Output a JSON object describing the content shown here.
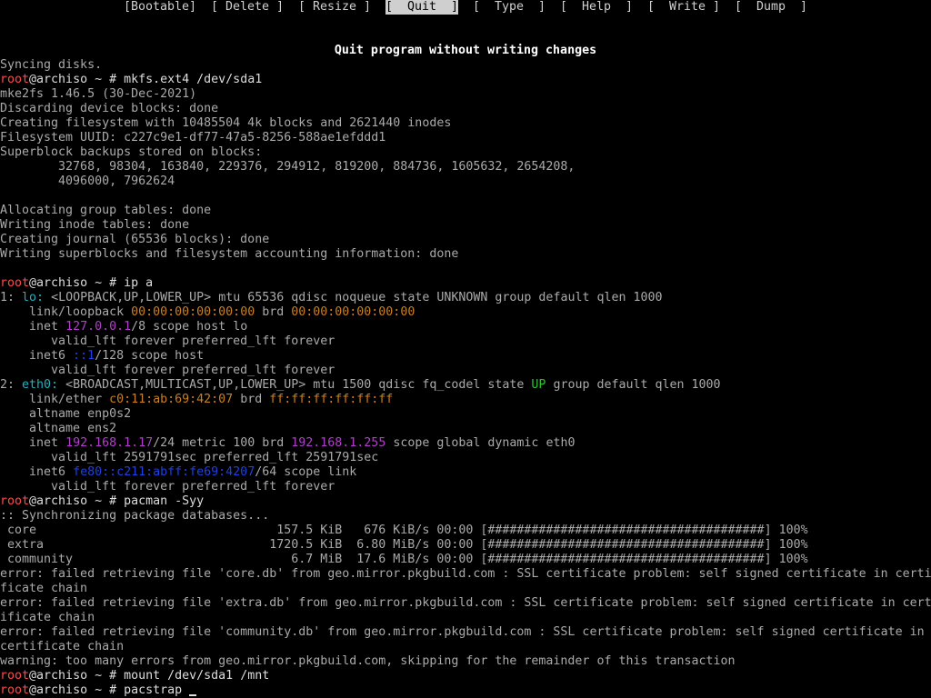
{
  "menu": {
    "items": [
      {
        "label": "[Bootable]",
        "selected": false
      },
      {
        "label": "[ Delete ]",
        "selected": false
      },
      {
        "label": "[ Resize ]",
        "selected": false
      },
      {
        "label": "[  Quit  ]",
        "selected": true
      },
      {
        "label": "[  Type  ]",
        "selected": false
      },
      {
        "label": "[  Help  ]",
        "selected": false
      },
      {
        "label": "[  Write ]",
        "selected": false
      },
      {
        "label": "[  Dump  ]",
        "selected": false
      }
    ]
  },
  "status_message": "Quit program without writing changes",
  "terminal_lines": [
    [
      {
        "t": "Syncing disks."
      }
    ],
    [
      {
        "t": "root",
        "c": "red"
      },
      {
        "t": "@archiso ~ # mkfs.ext4 /dev/sda1",
        "c": "white"
      }
    ],
    [
      {
        "t": "mke2fs 1.46.5 (30-Dec-2021)"
      }
    ],
    [
      {
        "t": "Discarding device blocks: done"
      }
    ],
    [
      {
        "t": "Creating filesystem with 10485504 4k blocks and 2621440 inodes"
      }
    ],
    [
      {
        "t": "Filesystem UUID: c227c9e1-df77-47a5-8256-588ae1efddd1"
      }
    ],
    [
      {
        "t": "Superblock backups stored on blocks:"
      }
    ],
    [
      {
        "t": "        32768, 98304, 163840, 229376, 294912, 819200, 884736, 1605632, 2654208,"
      }
    ],
    [
      {
        "t": "        4096000, 7962624"
      }
    ],
    [
      {
        "t": ""
      }
    ],
    [
      {
        "t": "Allocating group tables: done"
      }
    ],
    [
      {
        "t": "Writing inode tables: done"
      }
    ],
    [
      {
        "t": "Creating journal (65536 blocks): done"
      }
    ],
    [
      {
        "t": "Writing superblocks and filesystem accounting information: done"
      }
    ],
    [
      {
        "t": ""
      }
    ],
    [
      {
        "t": "root",
        "c": "red"
      },
      {
        "t": "@archiso ~ # ip a",
        "c": "white"
      }
    ],
    [
      {
        "t": "1: "
      },
      {
        "t": "lo:",
        "c": "cyan"
      },
      {
        "t": " <LOOPBACK,UP,LOWER_UP> mtu 65536 qdisc noqueue state UNKNOWN group default qlen 1000"
      }
    ],
    [
      {
        "t": "    link/loopback "
      },
      {
        "t": "00:00:00:00:00:00",
        "c": "orange"
      },
      {
        "t": " brd "
      },
      {
        "t": "00:00:00:00:00:00",
        "c": "orange"
      }
    ],
    [
      {
        "t": "    inet "
      },
      {
        "t": "127.0.0.1",
        "c": "magenta"
      },
      {
        "t": "/8 scope host lo"
      }
    ],
    [
      {
        "t": "       valid_lft forever preferred_lft forever"
      }
    ],
    [
      {
        "t": "    inet6 "
      },
      {
        "t": "::1",
        "c": "blue"
      },
      {
        "t": "/128 scope host"
      }
    ],
    [
      {
        "t": "       valid_lft forever preferred_lft forever"
      }
    ],
    [
      {
        "t": "2: "
      },
      {
        "t": "eth0:",
        "c": "cyan"
      },
      {
        "t": " <BROADCAST,MULTICAST,UP,LOWER_UP> mtu 1500 qdisc fq_codel state "
      },
      {
        "t": "UP",
        "c": "green"
      },
      {
        "t": " group default qlen 1000"
      }
    ],
    [
      {
        "t": "    link/ether "
      },
      {
        "t": "c0:11:ab:69:42:07",
        "c": "orange"
      },
      {
        "t": " brd "
      },
      {
        "t": "ff:ff:ff:ff:ff:ff",
        "c": "orange"
      }
    ],
    [
      {
        "t": "    altname enp0s2"
      }
    ],
    [
      {
        "t": "    altname ens2"
      }
    ],
    [
      {
        "t": "    inet "
      },
      {
        "t": "192.168.1.17",
        "c": "magenta"
      },
      {
        "t": "/24 metric 100 brd "
      },
      {
        "t": "192.168.1.255",
        "c": "magenta"
      },
      {
        "t": " scope global dynamic eth0"
      }
    ],
    [
      {
        "t": "       valid_lft 2591791sec preferred_lft 2591791sec"
      }
    ],
    [
      {
        "t": "    inet6 "
      },
      {
        "t": "fe80::c211:abff:fe69:4207",
        "c": "blue"
      },
      {
        "t": "/64 scope link"
      }
    ],
    [
      {
        "t": "       valid_lft forever preferred_lft forever"
      }
    ],
    [
      {
        "t": "root",
        "c": "red"
      },
      {
        "t": "@archiso ~ # pacman -Syy",
        "c": "white"
      }
    ],
    [
      {
        "t": ":: Synchronizing package databases..."
      }
    ],
    [
      {
        "t": " core                                 157.5 KiB   676 KiB/s 00:00 [######################################] 100%"
      }
    ],
    [
      {
        "t": " extra                               1720.5 KiB  6.80 MiB/s 00:00 [######################################] 100%"
      }
    ],
    [
      {
        "t": " community                              6.7 MiB  17.6 MiB/s 00:00 [######################################] 100%"
      }
    ],
    [
      {
        "t": "error: failed retrieving file 'core.db' from geo.mirror.pkgbuild.com : SSL certificate problem: self signed certificate in certi"
      }
    ],
    [
      {
        "t": "ficate chain"
      }
    ],
    [
      {
        "t": "error: failed retrieving file 'extra.db' from geo.mirror.pkgbuild.com : SSL certificate problem: self signed certificate in cert"
      }
    ],
    [
      {
        "t": "ificate chain"
      }
    ],
    [
      {
        "t": "error: failed retrieving file 'community.db' from geo.mirror.pkgbuild.com : SSL certificate problem: self signed certificate in"
      }
    ],
    [
      {
        "t": "certificate chain"
      }
    ],
    [
      {
        "t": "warning: too many errors from geo.mirror.pkgbuild.com, skipping for the remainder of this transaction"
      }
    ],
    [
      {
        "t": "root",
        "c": "red"
      },
      {
        "t": "@archiso ~ # mount /dev/sda1 /mnt",
        "c": "white"
      }
    ],
    [
      {
        "t": "root",
        "c": "red"
      },
      {
        "t": "@archiso ~ # pacstrap ",
        "c": "white"
      }
    ]
  ]
}
